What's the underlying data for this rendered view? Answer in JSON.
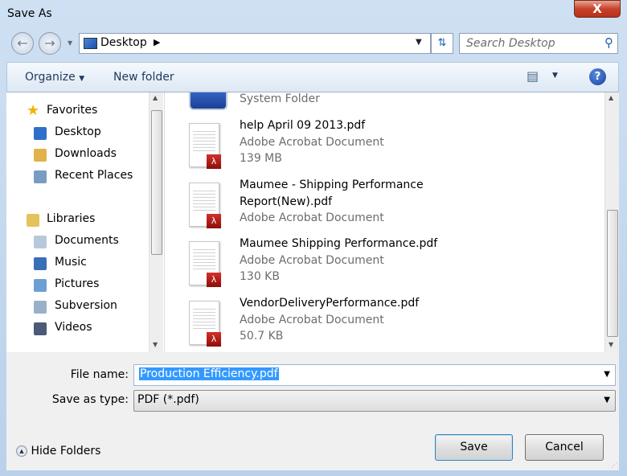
{
  "window": {
    "title": "Save As",
    "close_label": "X"
  },
  "address": {
    "location": "Desktop",
    "search_placeholder": "Search Desktop"
  },
  "toolbar": {
    "organize": "Organize",
    "new_folder": "New folder",
    "help": "?"
  },
  "sidebar": {
    "items": [
      {
        "label": "Favorites",
        "icon": "star-icon",
        "color": "#f0b400",
        "level": 0
      },
      {
        "label": "Desktop",
        "icon": "desktop-icon",
        "color": "#2f6fc9",
        "level": 1
      },
      {
        "label": "Downloads",
        "icon": "downloads-folder-icon",
        "color": "#e2b34a",
        "level": 1
      },
      {
        "label": "Recent Places",
        "icon": "recent-places-icon",
        "color": "#7a9cc4",
        "level": 1
      },
      {
        "label": "Libraries",
        "icon": "libraries-icon",
        "color": "#e6c25c",
        "level": 0
      },
      {
        "label": "Documents",
        "icon": "documents-icon",
        "color": "#b8c8dc",
        "level": 1
      },
      {
        "label": "Music",
        "icon": "music-icon",
        "color": "#3a6fb8",
        "level": 1
      },
      {
        "label": "Pictures",
        "icon": "pictures-icon",
        "color": "#6e9fd4",
        "level": 1
      },
      {
        "label": "Subversion",
        "icon": "subversion-icon",
        "color": "#9ab0c8",
        "level": 1
      },
      {
        "label": "Videos",
        "icon": "videos-icon",
        "color": "#4a5a78",
        "level": 1
      }
    ]
  },
  "files": {
    "partial": {
      "type": "System Folder"
    },
    "items": [
      {
        "name": [
          "help April 09 2013.pdf"
        ],
        "type": "Adobe Acrobat Document",
        "size": "139 MB"
      },
      {
        "name": [
          "Maumee - Shipping Performance",
          "Report(New).pdf"
        ],
        "type": "Adobe Acrobat Document",
        "size": ""
      },
      {
        "name": [
          "Maumee Shipping Performance.pdf"
        ],
        "type": "Adobe Acrobat Document",
        "size": "130 KB"
      },
      {
        "name": [
          "VendorDeliveryPerformance.pdf"
        ],
        "type": "Adobe Acrobat Document",
        "size": "50.7 KB"
      }
    ]
  },
  "form": {
    "file_name_label": "File name:",
    "file_name_value": "Production Efficiency.pdf",
    "type_label": "Save as type:",
    "type_value": "PDF (*.pdf)"
  },
  "buttons": {
    "hide_folders": "Hide Folders",
    "save": "Save",
    "cancel": "Cancel"
  }
}
